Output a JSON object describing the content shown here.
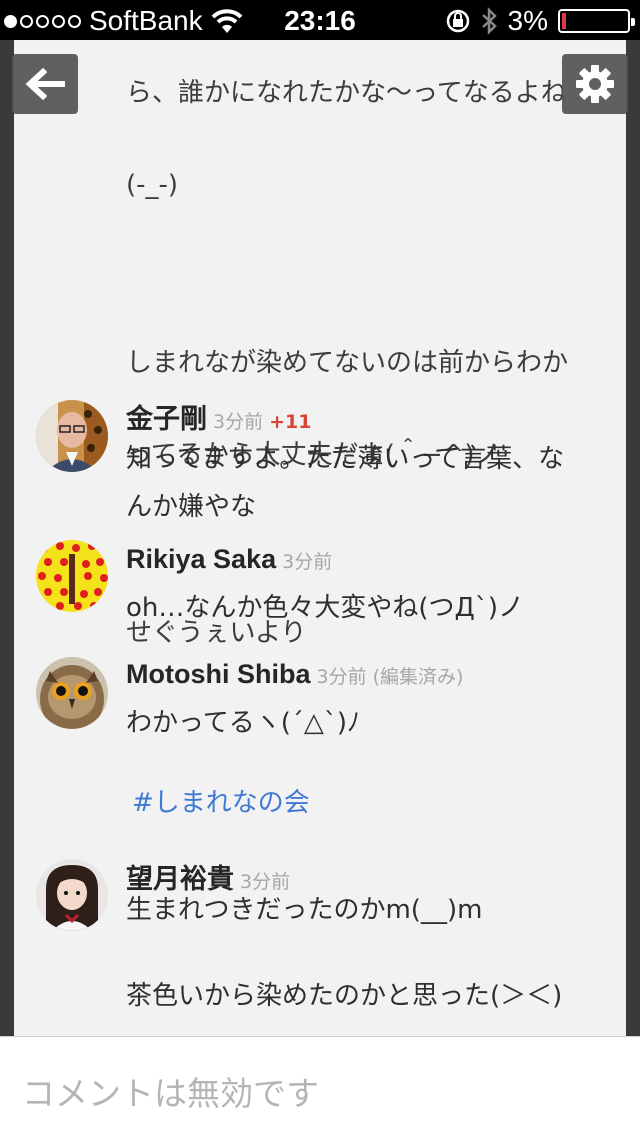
{
  "status_bar": {
    "carrier": "SoftBank",
    "time": "23:16",
    "battery_text": "3%",
    "battery_level": 0.03,
    "signal_bars": 1,
    "colors": {
      "battery_low": "#e0364a"
    }
  },
  "post": {
    "lines": [
      "ら、誰かになれたかな〜ってなるよね",
      "(-_-)",
      "",
      "しまれなが染めてないのは前からわか",
      "ってるから大丈夫だよ(＾−^)ノ",
      "",
      "せぐうぇいより"
    ]
  },
  "comments": [
    {
      "name": "金子剛",
      "time": "3分前",
      "plus": "+11",
      "text": "知ってますよ。ただ薄いって言葉、な\nんか嫌やな",
      "avatar_icon": "man-glasses-avatar"
    },
    {
      "name": "Rikiya Saka",
      "time": "3分前",
      "text": "oh…なんか色々大変やね(つД`)ノ",
      "avatar_icon": "hearts-pattern-avatar"
    },
    {
      "name": "Motoshi Shiba",
      "time": "3分前",
      "edited": "(編集済み)",
      "text": "わかってるヽ(´△`)ﾉ",
      "avatar_icon": "owl-avatar"
    },
    {
      "name": "望月裕貴",
      "time": "3分前",
      "text": "生まれつきだったのかm(__)m\n\n茶色いから染めたのかと思った(＞＜)",
      "avatar_icon": "girl-avatar"
    }
  ],
  "hashtag": "#しまれなの会",
  "buttons": {
    "back_icon": "arrow-left-icon",
    "settings_icon": "gear-icon"
  },
  "footer": {
    "comments_disabled": "コメントは無効です"
  },
  "colors": {
    "hashtag": "#3f79d3",
    "plus_one": "#d64535",
    "timestamp": "#a7a7a7"
  }
}
